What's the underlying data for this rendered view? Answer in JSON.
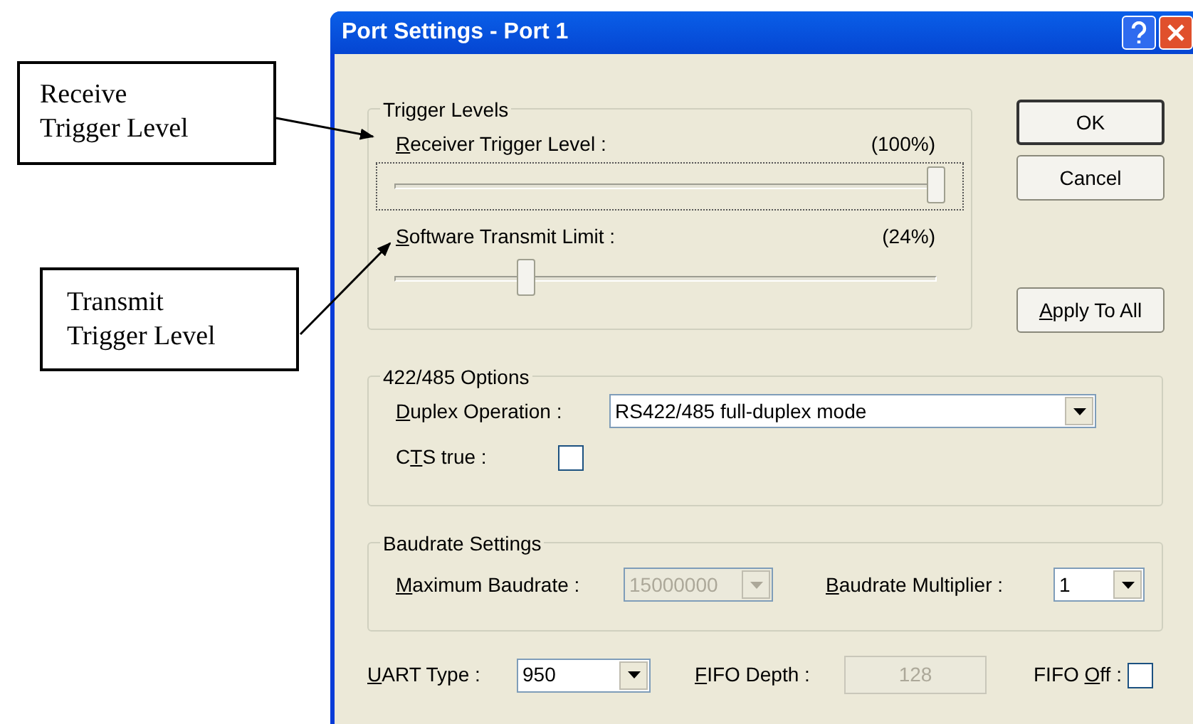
{
  "callouts": [
    {
      "lines": [
        "Receive",
        "Trigger Level"
      ]
    },
    {
      "lines": [
        "Transmit",
        "Trigger Level"
      ]
    }
  ],
  "window": {
    "title": "Port Settings - Port 1"
  },
  "trigger_levels": {
    "title": "Trigger Levels",
    "sliders": [
      {
        "label": {
          "accel": "R",
          "after": "eceiver Trigger Level :"
        },
        "reading": "(100%)",
        "level": 1,
        "focused": true
      },
      {
        "label": {
          "accel": "S",
          "after": "oftware Transmit Limit :"
        },
        "reading": "(24%)",
        "level": 0.24,
        "focused": false
      }
    ]
  },
  "buttons": [
    {
      "label": {
        "before": "OK"
      },
      "default": true
    },
    {
      "label": {
        "before": "Cancel"
      },
      "default": false
    },
    {
      "label": {
        "accel": "A",
        "after": "pply To All"
      },
      "default": false
    }
  ],
  "options_422_485": {
    "title": "422/485 Options",
    "duplex_operation": {
      "label": {
        "accel": "D",
        "after": "uplex Operation :"
      },
      "value": "RS422/485 full-duplex mode",
      "disabled": false
    },
    "cts_true": {
      "label": {
        "before": "C",
        "accel": "T",
        "after": "S true :"
      },
      "checked": false
    }
  },
  "baudrate_settings": {
    "title": "Baudrate Settings",
    "maximum_baudrate": {
      "label": {
        "accel": "M",
        "after": "aximum Baudrate :"
      },
      "value": "15000000",
      "disabled": true
    },
    "baudrate_multiplier": {
      "label": {
        "accel": "B",
        "after": "audrate Multiplier :"
      },
      "value": "1",
      "disabled": false
    }
  },
  "uart_type": {
    "label": {
      "accel": "U",
      "after": "ART Type :"
    },
    "value": "950",
    "disabled": false
  },
  "fifo_depth": {
    "label": {
      "accel": "F",
      "after": "IFO Depth :"
    },
    "value": "128",
    "disabled": true
  },
  "fifo_off": {
    "label": {
      "before": "FIFO ",
      "accel": "O",
      "after": "ff :"
    },
    "checked": false
  }
}
